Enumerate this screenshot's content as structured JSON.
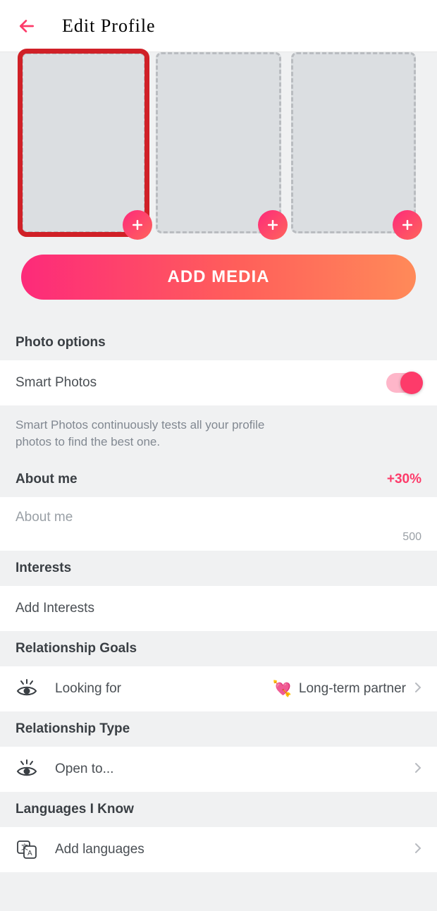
{
  "header": {
    "title": "Edit Profile"
  },
  "addMedia": {
    "label": "ADD MEDIA"
  },
  "photoOptions": {
    "title": "Photo options",
    "smartPhotos": {
      "label": "Smart Photos",
      "enabled": true
    },
    "hint": "Smart Photos continuously tests all your profile photos to find the best one."
  },
  "aboutMe": {
    "title": "About me",
    "bonus": "+30%",
    "placeholder": "About me",
    "counter": "500"
  },
  "interests": {
    "title": "Interests",
    "addLabel": "Add Interests"
  },
  "relationshipGoals": {
    "title": "Relationship Goals",
    "label": "Looking for",
    "value": "Long-term partner"
  },
  "relationshipType": {
    "title": "Relationship Type",
    "label": "Open to..."
  },
  "languages": {
    "title": "Languages I Know",
    "label": "Add languages"
  }
}
